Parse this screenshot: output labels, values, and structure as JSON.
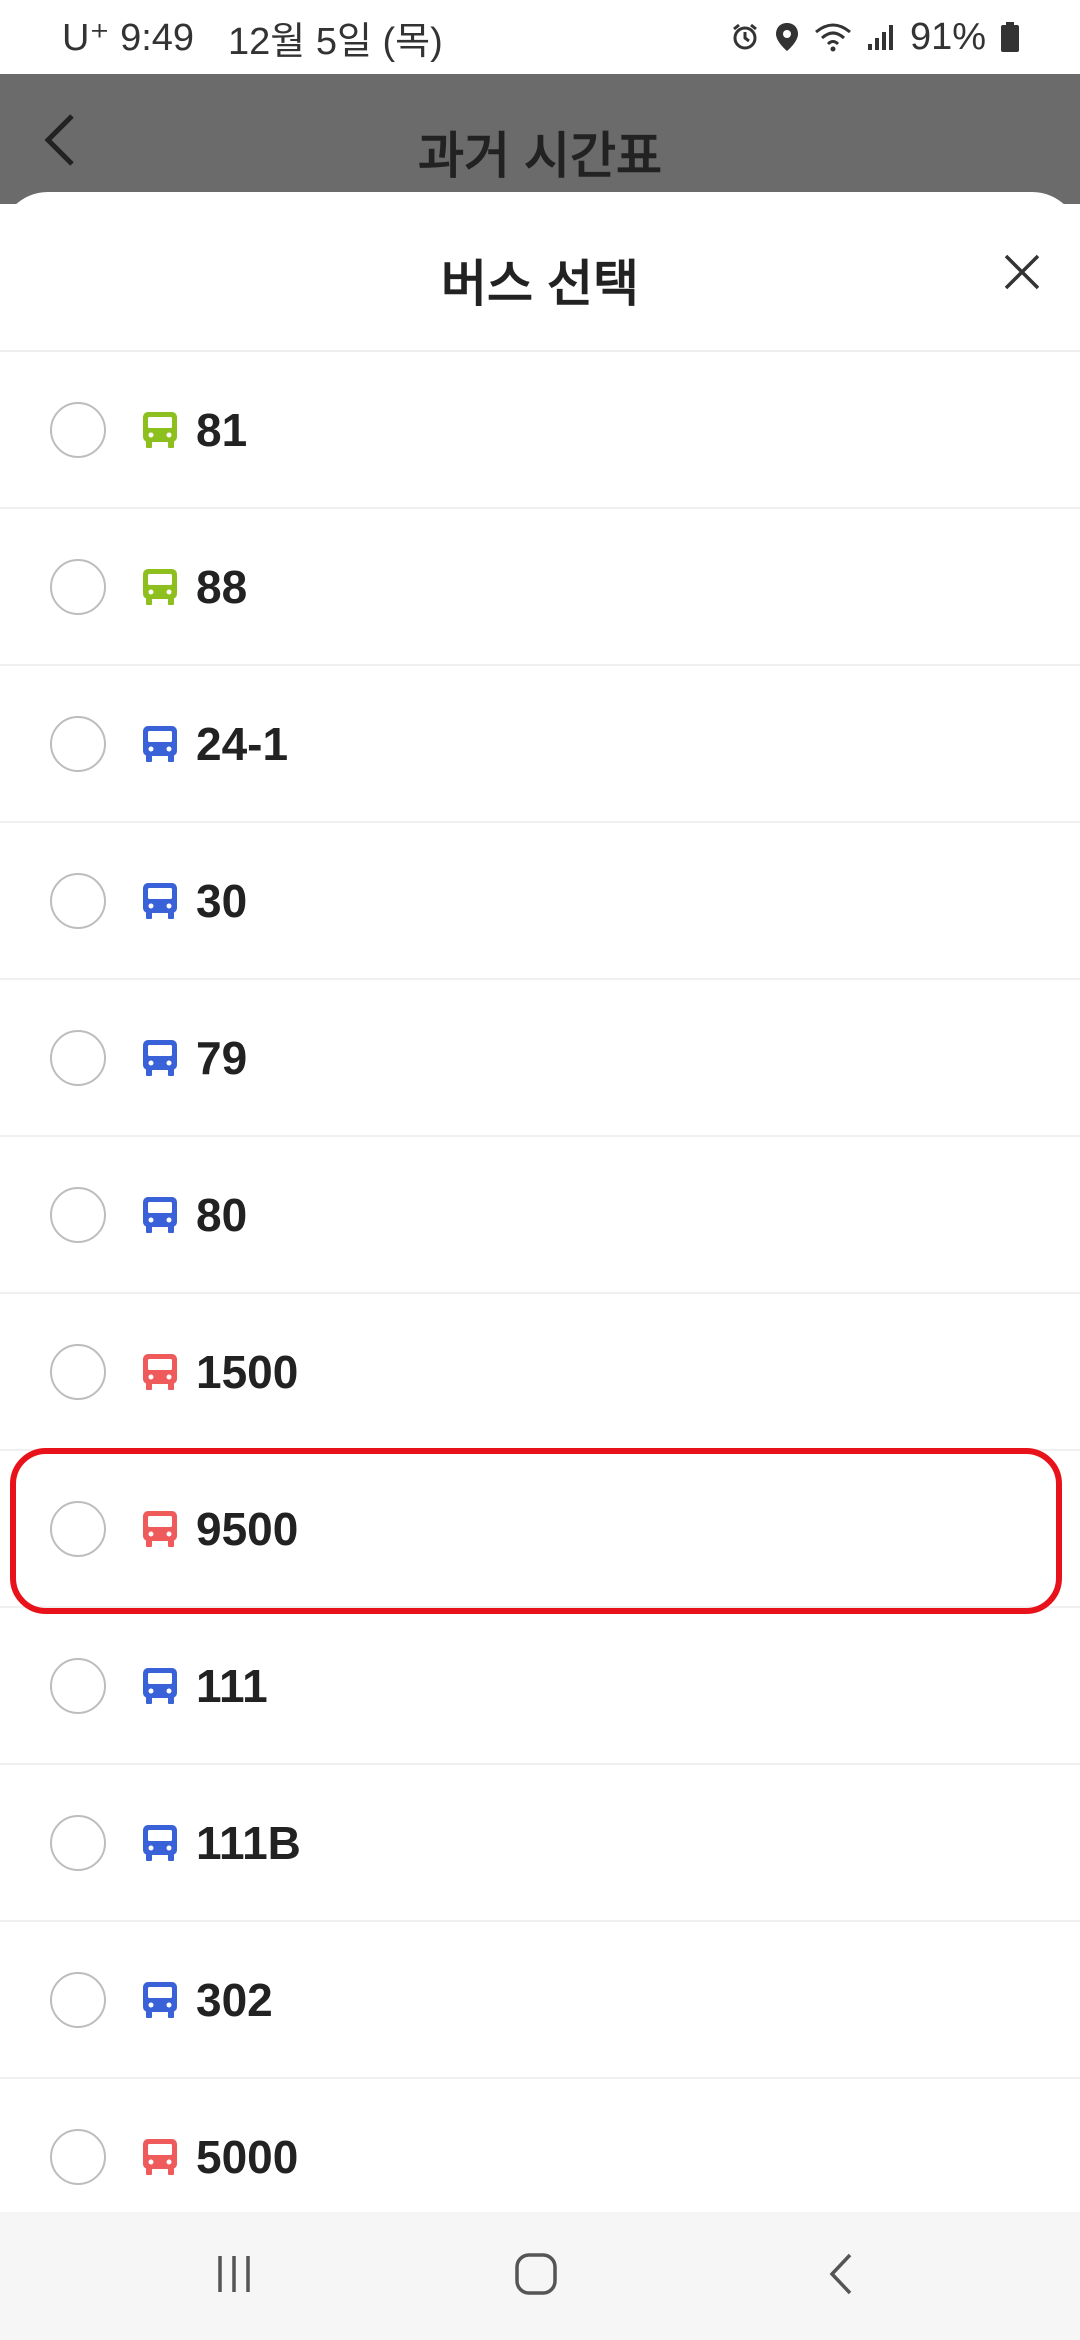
{
  "status": {
    "carrier": "U⁺",
    "time": "9:49",
    "date": "12월 5일 (목)",
    "battery": "91%"
  },
  "header": {
    "title": "과거 시간표"
  },
  "sheet": {
    "title": "버스 선택"
  },
  "buses": [
    {
      "number": "81",
      "color": "#8dbf1f"
    },
    {
      "number": "88",
      "color": "#8dbf1f"
    },
    {
      "number": "24-1",
      "color": "#3a62d8"
    },
    {
      "number": "30",
      "color": "#3a62d8"
    },
    {
      "number": "79",
      "color": "#3a62d8"
    },
    {
      "number": "80",
      "color": "#3a62d8"
    },
    {
      "number": "1500",
      "color": "#ef5a5a"
    },
    {
      "number": "9500",
      "color": "#ef5a5a"
    },
    {
      "number": "111",
      "color": "#3a62d8"
    },
    {
      "number": "111B",
      "color": "#3a62d8"
    },
    {
      "number": "302",
      "color": "#3a62d8"
    },
    {
      "number": "5000",
      "color": "#ef5a5a"
    }
  ],
  "colors": {
    "highlight": "#e8121b",
    "green_bus": "#8dbf1f",
    "blue_bus": "#3a62d8",
    "red_bus": "#ef5a5a"
  }
}
